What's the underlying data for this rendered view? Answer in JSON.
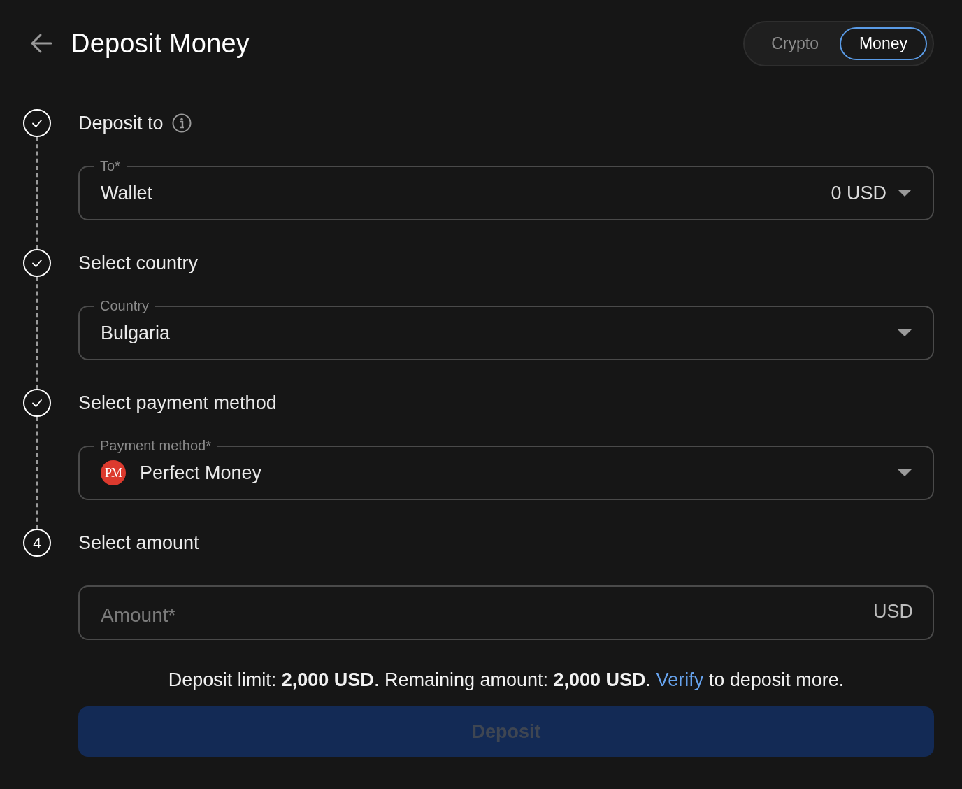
{
  "header": {
    "title": "Deposit Money"
  },
  "toggle": [
    {
      "label": "Crypto",
      "selected": false
    },
    {
      "label": "Money",
      "selected": true
    }
  ],
  "steps": [
    {
      "title": "Deposit to",
      "completed": true,
      "info": true,
      "field": {
        "kind": "select",
        "label": "To*",
        "value": "Wallet",
        "suffix": "0 USD"
      }
    },
    {
      "title": "Select country",
      "completed": true,
      "info": false,
      "field": {
        "kind": "select",
        "label": "Country",
        "value": "Bulgaria"
      }
    },
    {
      "title": "Select payment method",
      "completed": true,
      "info": false,
      "field": {
        "kind": "select",
        "label": "Payment method*",
        "value": "Perfect Money",
        "logo": "PM"
      }
    },
    {
      "title": "Select amount",
      "completed": false,
      "number": "4",
      "info": false,
      "field": {
        "kind": "input",
        "placeholder": "Amount*",
        "suffix": "USD"
      }
    }
  ],
  "notice": {
    "text": "Deposit limit: **2,000 USD**. Remaining amount: **2,000 USD**.",
    "link": "Verify",
    "after": "to deposit more."
  },
  "deposit_button": {
    "label": "Deposit",
    "disabled": true
  }
}
